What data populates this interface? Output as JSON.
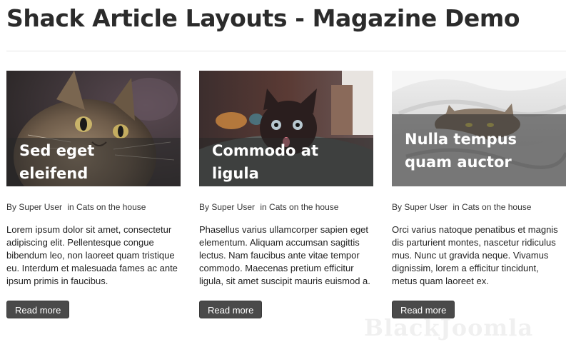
{
  "page": {
    "title": "Shack Article Layouts - Magazine Demo"
  },
  "articles": [
    {
      "headline": "Sed eget eleifend",
      "author": "By Super User",
      "category": "in Cats on the house",
      "body": "Lorem ipsum dolor sit amet, consectetur adipiscing elit. Pellentesque congue bibendum leo, non laoreet quam tristique eu. Interdum et malesuada fames ac ante ipsum primis in faucibus.",
      "read_more": "Read more",
      "image": "tabby-cat-photo"
    },
    {
      "headline": "Commodo at ligula",
      "author": "By Super User",
      "category": "in Cats on the house",
      "body": "Phasellus varius ullamcorper sapien eget elementum. Aliquam accumsan sagittis lectus. Nam faucibus ante vitae tempor commodo. Maecenas pretium efficitur ligula, sit amet suscipit mauris euismod a.",
      "read_more": "Read more",
      "image": "black-kitten-photo"
    },
    {
      "headline": "Nulla tempus quam auctor",
      "author": "By Super User",
      "category": "in Cats on the house",
      "body": "Orci varius natoque penatibus et magnis dis parturient montes, nascetur ridiculus mus. Nunc ut gravida neque. Vivamus dignissim, lorem a efficitur tincidunt, metus quam laoreet ex.",
      "read_more": "Read more",
      "image": "cat-under-blanket-photo"
    }
  ],
  "watermark": "BlackJoomla"
}
